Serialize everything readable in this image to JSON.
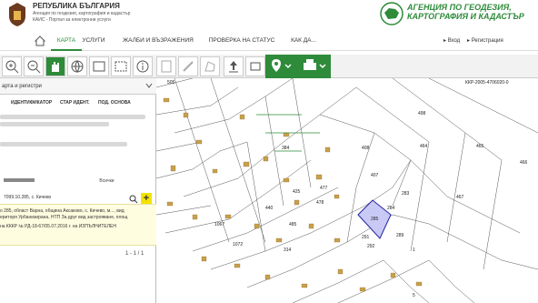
{
  "header": {
    "gov_title": "РЕПУБЛИКА БЪЛГАРИЯ",
    "gov_line1": "Агенция по геодезия, картография и кадастър",
    "gov_line2": "КАИС - Портал за електронни услуги",
    "agency_line1": "АГЕНЦИЯ ПО ГЕОДЕЗИЯ,",
    "agency_line2": "КАРТОГРАФИЯ И КАДАСТЪР"
  },
  "nav": {
    "items": [
      "КАРТА",
      "УСЛУГИ",
      "ЖАЛБИ И ВЪЗРАЖЕНИЯ",
      "ПРОВЕРКА НА СТАТУС",
      "КАК ДА..."
    ],
    "login": "Вход",
    "register": "Регистрация"
  },
  "panel": {
    "title": "арта и регистри",
    "col1": "ИДЕНТИФИКАТОР",
    "col2": "СТАР ИДЕНТ.",
    "col3": "ПОД. ОСНОВА",
    "all": "Всички",
    "search_value": "7099.10.285, с. Кичево",
    "result_line1": "о 285, област Варна, община Аксаково, с. Кичево, м..., вид",
    "result_line2": "ериторя Урбанизирана, НТП За друг вид застрояване, площ",
    "result_line3": "на КККР № РД-18-67/05.07.2016 г. на ИЗПЪЛНИТЕЛЕН",
    "pager": "1 - 1 / 1"
  },
  "map": {
    "ref_label": "ККР-2005-4706020-0",
    "labels": [
      "505",
      "498",
      "464",
      "465",
      "466",
      "384",
      "408",
      "407",
      "285",
      "284",
      "283",
      "467",
      "291",
      "292",
      "289",
      "440",
      "485",
      "1067",
      "1072",
      "425",
      "478",
      "477",
      "1",
      "314",
      "5"
    ]
  },
  "colors": {
    "accent": "#2e8b3a",
    "highlight": "#2020a0",
    "map_buildings": "#c8a04c"
  }
}
